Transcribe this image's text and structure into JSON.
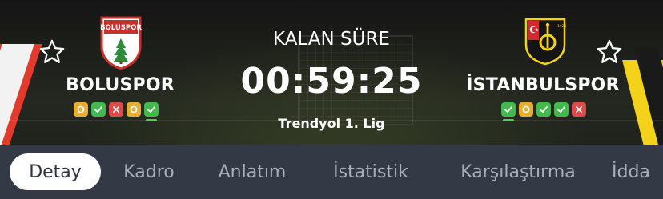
{
  "match": {
    "home": {
      "name": "BOLUSPOR",
      "crest_text": "BOLUSPOR",
      "form": [
        "draw",
        "win",
        "loss",
        "draw",
        "win"
      ],
      "form_highlight_index": 4
    },
    "away": {
      "name": "İSTANBULSPOR",
      "form": [
        "win",
        "draw",
        "win",
        "win",
        "loss"
      ],
      "form_highlight_index": 0
    },
    "remaining_label": "KALAN SÜRE",
    "countdown": "00:59:25",
    "league": "Trendyol 1. Lig"
  },
  "tabs": [
    {
      "label": "Detay",
      "active": true
    },
    {
      "label": "Kadro",
      "active": false
    },
    {
      "label": "Anlatım",
      "active": false
    },
    {
      "label": "İstatistik",
      "active": false
    },
    {
      "label": "Karşılaştırma",
      "active": false
    },
    {
      "label": "İdda",
      "active": false
    }
  ],
  "colors": {
    "win": "#43b94d",
    "draw": "#e8ae2f",
    "loss": "#dc4a4a",
    "tabbar": "#333945",
    "home_primary": "#e23b2c",
    "away_primary": "#f4d21a"
  }
}
